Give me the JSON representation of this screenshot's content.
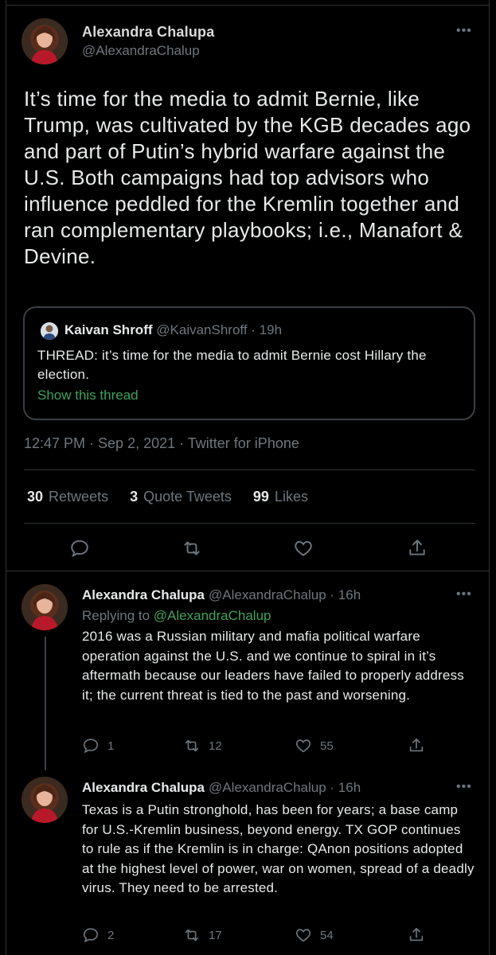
{
  "main_tweet": {
    "author_name": "Alexandra Chalupa",
    "author_handle": "@AlexandraChalup",
    "more_icon": "ellipsis-icon",
    "text": "It’s time for the media to admit Bernie, like Trump, was cultivated by the KGB decades ago and part of Putin’s hybrid warfare against the U.S. Both campaigns had top advisors who influence peddled for the Kremlin together and ran complementary playbooks; i.e., Manafort & Devine.",
    "quote": {
      "author_name": "Kaivan Shroff",
      "author_handle": "@KaivanShroff · 19h",
      "text": "THREAD: it’s time for the media to admit Bernie cost Hillary the election.",
      "link": "Show this thread"
    },
    "meta": "12:47 PM · Sep 2, 2021 · Twitter for iPhone",
    "stats": {
      "retweets_count": "30",
      "retweets_label": "Retweets",
      "quotes_count": "3",
      "quotes_label": "Quote Tweets",
      "likes_count": "99",
      "likes_label": "Likes"
    }
  },
  "replies": [
    {
      "author_name": "Alexandra Chalupa",
      "author_meta": "@AlexandraChalup · 16h",
      "replying_prefix": "Replying to",
      "replying_to": "@AlexandraChalup",
      "text": "2016 was a Russian military and mafia political warfare operation against the U.S. and we continue to spiral in it’s aftermath because our leaders have failed to properly address it; the current threat is tied to the past and worsening.",
      "reply_count": "1",
      "retweet_count": "12",
      "like_count": "55"
    },
    {
      "author_name": "Alexandra Chalupa",
      "author_meta": "@AlexandraChalup · 16h",
      "text": "Texas is a Putin stronghold, has been for years; a base camp for U.S.-Kremlin business, beyond energy. TX GOP continues to rule as if the Kremlin is in charge: QAnon positions adopted at the highest level of power, war on women, spread of a deadly virus. They need to be arrested.",
      "reply_count": "2",
      "retweet_count": "17",
      "like_count": "54"
    }
  ],
  "colors": {
    "background": "#000000",
    "text": "#e7e9ea",
    "muted": "#6e767d",
    "link": "#3ea35a",
    "border": "#2f3336"
  }
}
